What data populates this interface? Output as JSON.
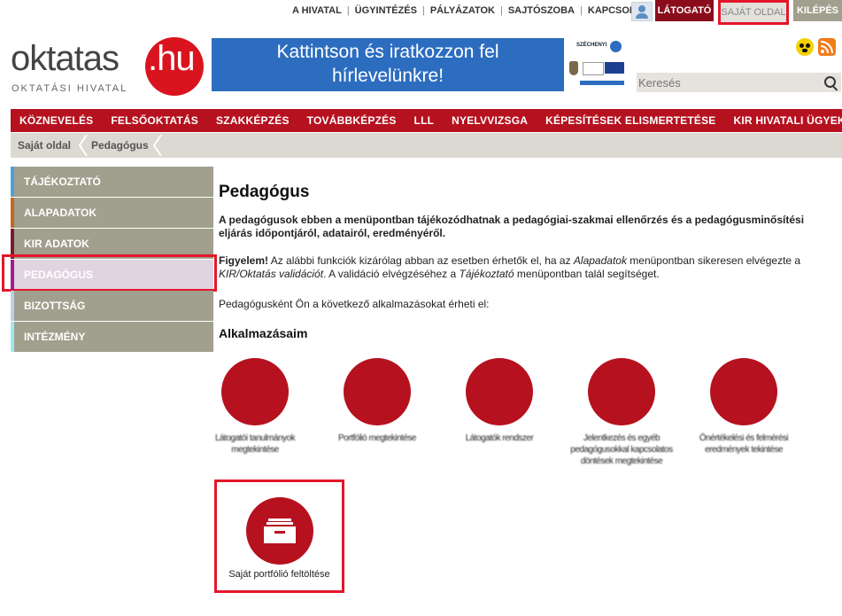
{
  "topbar": {
    "links": [
      "A HIVATAL",
      "ÜGYINTÉZÉS",
      "PÁLYÁZATOK",
      "SAJTÓSZOBA",
      "KAPCSOLAT"
    ],
    "visitor": "LÁTOGATÓ",
    "own_page": "SAJÁT OLDAL",
    "exit": "KILÉPÉS"
  },
  "logo": {
    "word": "oktatas",
    "hu": ".hu",
    "sub": "OKTATÁSI HIVATAL"
  },
  "banner": {
    "line1": "Kattintson és iratkozzon fel",
    "line2": "hírlevelünkre!",
    "szechenyi": "SZÉCHENYI"
  },
  "search": {
    "placeholder": "Keresés"
  },
  "mainnav": [
    "KÖZNEVELÉS",
    "FELSŐOKTATÁS",
    "SZAKKÉPZÉS",
    "TOVÁBBKÉPZÉS",
    "LLL",
    "NYELVVIZSGA",
    "KÉPESÍTÉSEK ELISMERTETÉSE",
    "KIR HIVATALI ÜGYEK"
  ],
  "breadcrumb": [
    "Saját oldal",
    "Pedagógus"
  ],
  "sidebar": {
    "items": [
      {
        "label": "TÁJÉKOZTATÓ",
        "color": "#4aa3d6"
      },
      {
        "label": "ALAPADATOK",
        "color": "#c26a1e"
      },
      {
        "label": "KIR ADATOK",
        "color": "#7a1b2e"
      },
      {
        "label": "PEDAGÓGUS",
        "color": "#a21c8c"
      },
      {
        "label": "BIZOTTSÁG",
        "color": "#b8d3e4"
      },
      {
        "label": "INTÉZMÉNY",
        "color": "#a3e6f0"
      }
    ]
  },
  "page": {
    "title": "Pedagógus",
    "intro": "A pedagógusok ebben a menüpontban tájékozódhatnak a pedagógiai-szakmai ellenőrzés és a pedagógusminősítési eljárás időpontjáról, adatairól, eredményéről.",
    "warn_bold": "Figyelem!",
    "warn_1": " Az alábbi funkciók kizárólag abban az esetben érhetők el, ha az ",
    "warn_i1": "Alapadatok",
    "warn_2": " menüpontban sikeresen elvégezte a ",
    "warn_i2": "KIR/Oktatás validációt",
    "warn_3": ". A validáció elvégzéséhez a ",
    "warn_i3": "Tájékoztató",
    "warn_4": " menüpontban talál segítséget.",
    "info": "Pedagógusként Ön a következő alkalmazásokat érheti el:",
    "apps_title": "Alkalmazásaim"
  },
  "apps": [
    "Látogatói tanulmányok megtekintése",
    "Portfólió megtekintése",
    "Látogatók rendszer",
    "Jelentkezés és egyéb pedagógusokkal kapcsolatos döntések megtekintése",
    "Önértékelési és felmérési eredmények tekintése"
  ],
  "portfolio": {
    "label": "Saját portfólió feltöltése"
  }
}
